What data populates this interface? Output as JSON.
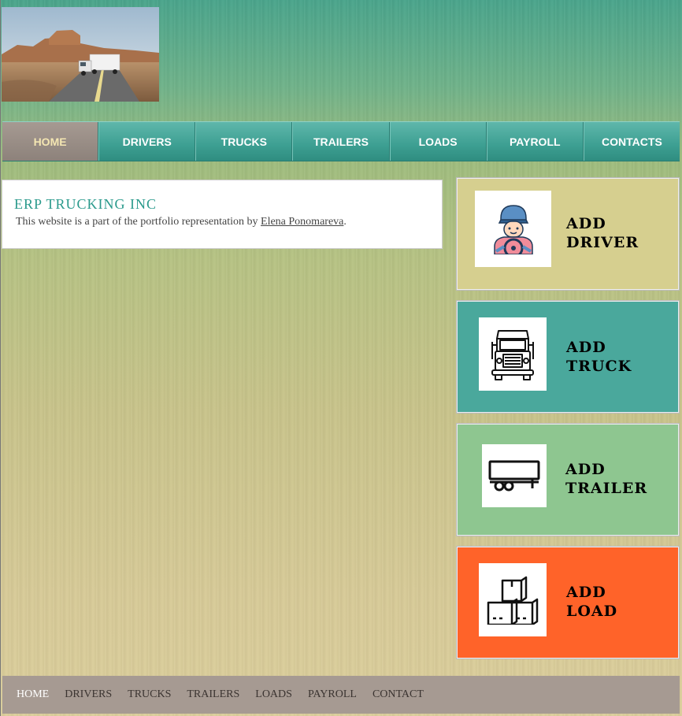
{
  "nav": {
    "items": [
      "HOME",
      "DRIVERS",
      "TRUCKS",
      "TRAILERS",
      "LOADS",
      "PAYROLL",
      "CONTACTS"
    ]
  },
  "card": {
    "title": "ERP TRUCKING INC",
    "text_before": "This website is a part of the portfolio representation by ",
    "link": "Elena Ponomareva",
    "text_after": "."
  },
  "tiles": [
    {
      "line1": "ADD",
      "line2": "DRIVER",
      "icon": "driver-icon",
      "color": "#d6cf8f"
    },
    {
      "line1": "ADD",
      "line2": "TRUCK",
      "icon": "truck-icon",
      "color": "#4aa89c"
    },
    {
      "line1": "ADD",
      "line2": "TRAILER",
      "icon": "trailer-icon",
      "color": "#8ec690"
    },
    {
      "line1": "ADD",
      "line2": "LOAD",
      "icon": "boxes-icon",
      "color": "#ff6329"
    }
  ],
  "footer": {
    "items": [
      "HOME",
      "DRIVERS",
      "TRUCKS",
      "TRAILERS",
      "LOADS",
      "PAYROLL",
      "CONTACT"
    ]
  },
  "colors": {
    "accent": "#2a9a8c",
    "nav_active": "#8d827b",
    "footer_bg": "#a69a92"
  }
}
